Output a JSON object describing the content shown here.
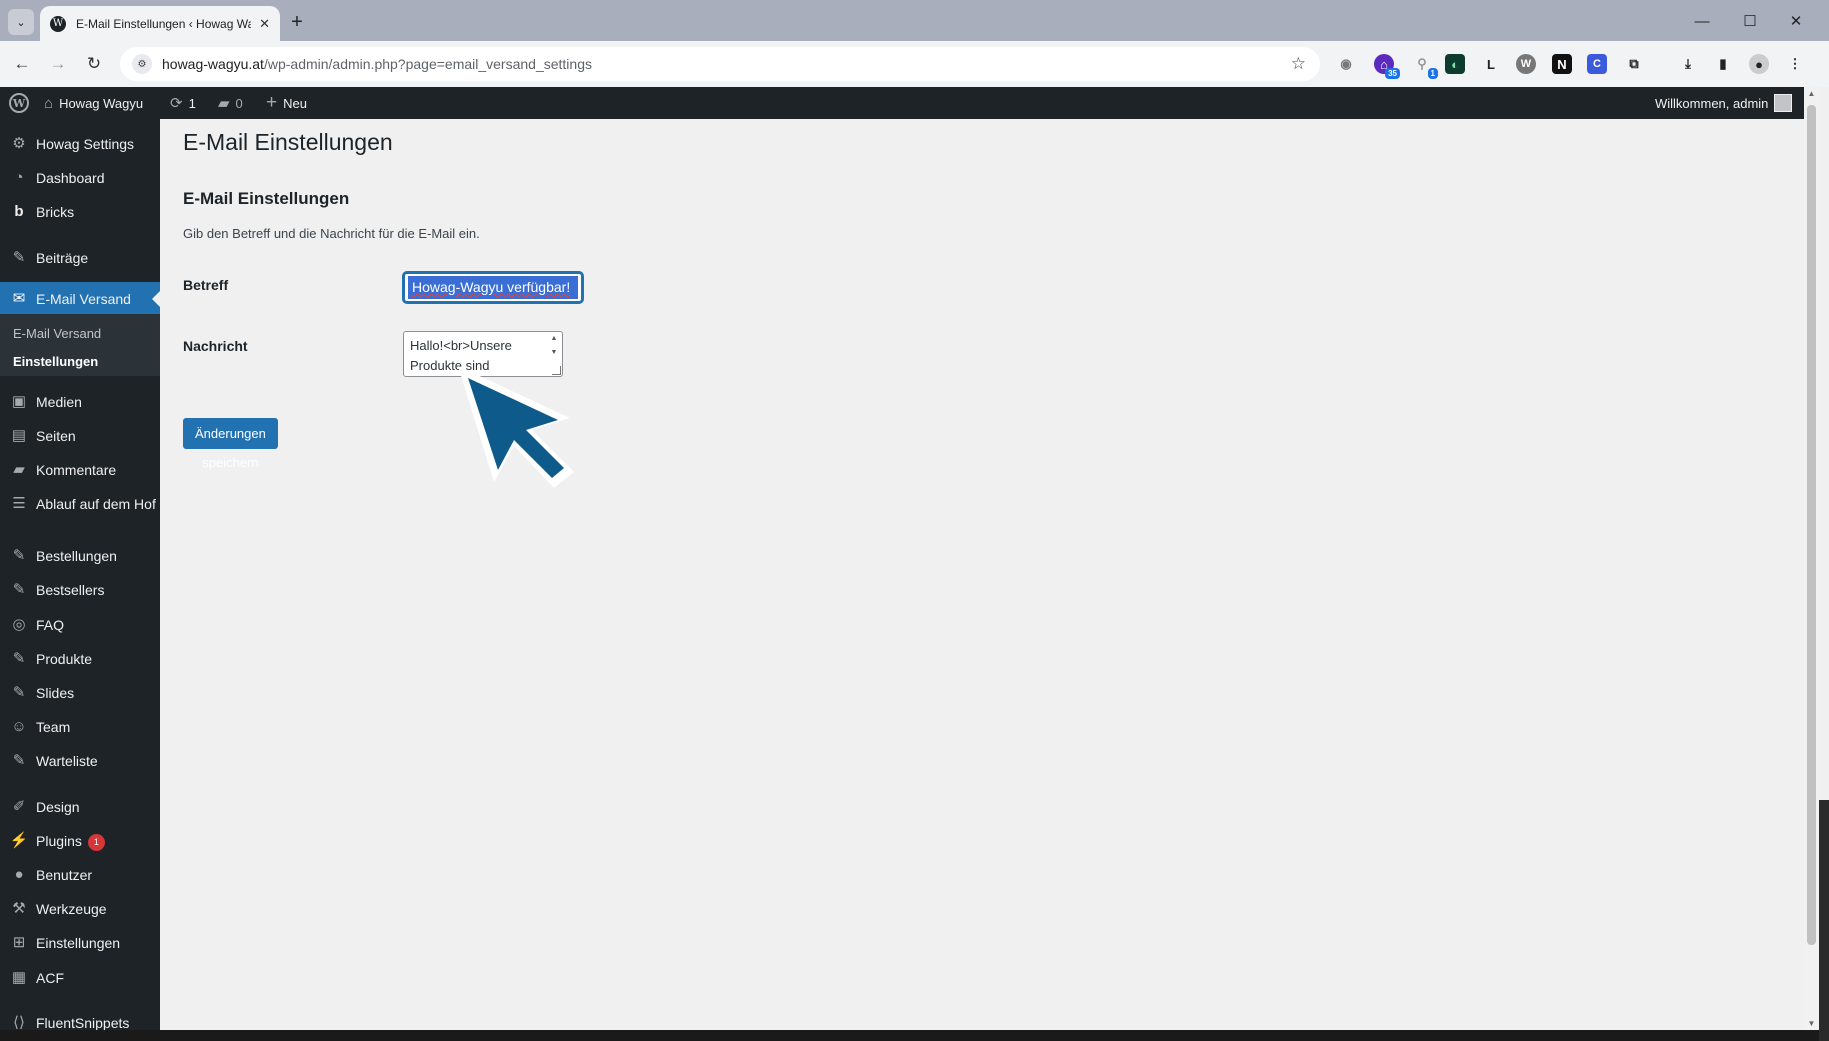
{
  "browser": {
    "tab_title": "E-Mail Einstellungen ‹ Howag Wagyu — WordPress",
    "url_host": "howag-wagyu.at",
    "url_path": "/wp-admin/admin.php?page=email_versand_settings",
    "extensions": [
      {
        "name": "camera-icon",
        "label": ""
      },
      {
        "name": "extension-badge-35",
        "label": "35"
      },
      {
        "name": "extension-badge-1",
        "label": "1"
      },
      {
        "name": "extension-green",
        "label": ""
      },
      {
        "name": "extension-l",
        "label": "L"
      },
      {
        "name": "extension-w",
        "label": "W"
      },
      {
        "name": "extension-n",
        "label": "N"
      },
      {
        "name": "extension-c",
        "label": "C"
      }
    ]
  },
  "adminbar": {
    "site_name": "Howag Wagyu",
    "updates_count": "1",
    "comments_count": "0",
    "new_label": "Neu",
    "welcome": "Willkommen, admin"
  },
  "sidebar": {
    "items": [
      {
        "label": "Howag Settings",
        "icon": "gear-icon"
      },
      {
        "label": "Dashboard",
        "icon": "dashboard-icon"
      },
      {
        "label": "Bricks",
        "icon": "bricks-icon"
      },
      {
        "label": "Beiträge",
        "icon": "pin-icon"
      },
      {
        "label": "E-Mail Versand",
        "icon": "mail-icon"
      },
      {
        "label": "Medien",
        "icon": "media-icon"
      },
      {
        "label": "Seiten",
        "icon": "pages-icon"
      },
      {
        "label": "Kommentare",
        "icon": "comment-icon"
      },
      {
        "label": "Ablauf auf dem Hof",
        "icon": "list-icon"
      },
      {
        "label": "Bestellungen",
        "icon": "pin-icon"
      },
      {
        "label": "Bestsellers",
        "icon": "pin-icon"
      },
      {
        "label": "FAQ",
        "icon": "help-icon"
      },
      {
        "label": "Produkte",
        "icon": "pin-icon"
      },
      {
        "label": "Slides",
        "icon": "pin-icon"
      },
      {
        "label": "Team",
        "icon": "person-icon"
      },
      {
        "label": "Warteliste",
        "icon": "pin-icon"
      },
      {
        "label": "Design",
        "icon": "brush-icon"
      },
      {
        "label": "Plugins",
        "icon": "plugin-icon"
      },
      {
        "label": "Benutzer",
        "icon": "users-icon"
      },
      {
        "label": "Werkzeuge",
        "icon": "wrench-icon"
      },
      {
        "label": "Einstellungen",
        "icon": "settings-icon"
      },
      {
        "label": "ACF",
        "icon": "acf-icon"
      },
      {
        "label": "FluentSnippets",
        "icon": "code-icon"
      }
    ],
    "submenu": [
      "E-Mail Versand",
      "Einstellungen"
    ],
    "plugins_count": "1"
  },
  "main": {
    "page_title": "E-Mail Einstellungen",
    "section_title": "E-Mail Einstellungen",
    "section_desc": "Gib den Betreff und die Nachricht für die E-Mail ein.",
    "betreff_label": "Betreff",
    "betreff_value": "Howag-Wagyu verfügbar!",
    "nachricht_label": "Nachricht",
    "nachricht_line1": "Hallo!<br>Unsere",
    "nachricht_line2": "Produkte sind",
    "save_label": "Änderungen speichern"
  },
  "colors": {
    "wp_dark": "#1d2327",
    "wp_blue": "#2271b1",
    "cursor_annotation": "#0e5a8a"
  }
}
